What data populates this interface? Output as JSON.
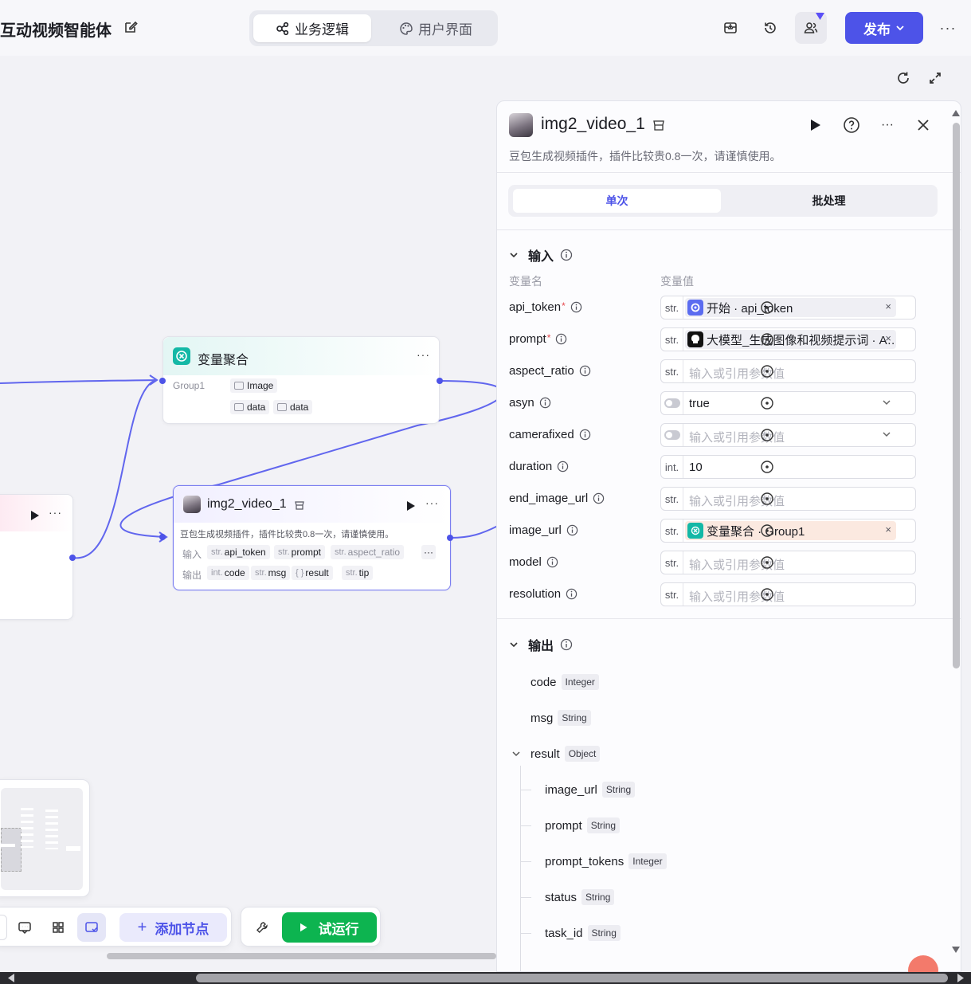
{
  "header": {
    "app_title": "互动视频智能体",
    "tabs": [
      {
        "label": "业务逻辑",
        "icon": "workflow-icon"
      },
      {
        "label": "用户界面",
        "icon": "palette-icon"
      }
    ],
    "publish_label": "发布",
    "more_label": "···"
  },
  "canvas": {
    "nodes": {
      "aggregate": {
        "title": "变量聚合",
        "group_label": "Group1",
        "tags": [
          "Image",
          "data",
          "data"
        ]
      },
      "img2video": {
        "title": "img2_video_1",
        "desc": "豆包生成视频插件，插件比较贵0.8一次，请谨慎使用。",
        "input_label": "输入",
        "output_label": "输出",
        "inputs": [
          {
            "type": "str.",
            "name": "api_token"
          },
          {
            "type": "str.",
            "name": "prompt"
          },
          {
            "type": "str.",
            "name": "aspect_ratio"
          }
        ],
        "outputs": [
          {
            "type": "int.",
            "name": "code"
          },
          {
            "type": "str.",
            "name": "msg"
          },
          {
            "type": "{ }",
            "name": "result"
          },
          {
            "type": "str.",
            "name": "tip"
          }
        ],
        "more_inputs": "···"
      }
    },
    "toolbar": {
      "add_node_label": "添加节点",
      "test_run_label": "试运行"
    }
  },
  "panel": {
    "title": "img2_video_1",
    "desc": "豆包生成视频插件，插件比较贵0.8一次，请谨慎使用。",
    "mode_tabs": [
      "单次",
      "批处理"
    ],
    "input_section": "输入",
    "col_var_name": "变量名",
    "col_var_value": "变量值",
    "params": [
      {
        "name": "api_token",
        "required": true,
        "type": "str.",
        "ref": "开始 · api_token",
        "ref_source": "start"
      },
      {
        "name": "prompt",
        "required": true,
        "type": "str.",
        "ref": "大模型_生成图像和视频提示词 · A…",
        "ref_source": "llm"
      },
      {
        "name": "aspect_ratio",
        "required": false,
        "type": "str.",
        "placeholder": "输入或引用参数值"
      },
      {
        "name": "asyn",
        "required": false,
        "type": "toggle",
        "value": "true",
        "dropdown": true
      },
      {
        "name": "camerafixed",
        "required": false,
        "type": "toggle",
        "placeholder": "输入或引用参数值",
        "dropdown": true
      },
      {
        "name": "duration",
        "required": false,
        "type": "int.",
        "value": "10"
      },
      {
        "name": "end_image_url",
        "required": false,
        "type": "str.",
        "placeholder": "输入或引用参数值"
      },
      {
        "name": "image_url",
        "required": false,
        "type": "str.",
        "ref": "变量聚合 · Group1",
        "ref_source": "aggregate"
      },
      {
        "name": "model",
        "required": false,
        "type": "str.",
        "placeholder": "输入或引用参数值"
      },
      {
        "name": "resolution",
        "required": false,
        "type": "str.",
        "placeholder": "输入或引用参数值"
      }
    ],
    "output_section": "输出",
    "outputs": [
      {
        "name": "code",
        "type": "Integer",
        "level": 0
      },
      {
        "name": "msg",
        "type": "String",
        "level": 0
      },
      {
        "name": "result",
        "type": "Object",
        "level": 0,
        "expanded": true
      },
      {
        "name": "image_url",
        "type": "String",
        "level": 1
      },
      {
        "name": "prompt",
        "type": "String",
        "level": 1
      },
      {
        "name": "prompt_tokens",
        "type": "Integer",
        "level": 1
      },
      {
        "name": "status",
        "type": "String",
        "level": 1
      },
      {
        "name": "task_id",
        "type": "String",
        "level": 1
      }
    ]
  },
  "colors": {
    "primary": "#4d53e8",
    "run_green": "#0db450",
    "aggregate_teal": "#14b8a6",
    "required_red": "#e5484d"
  }
}
